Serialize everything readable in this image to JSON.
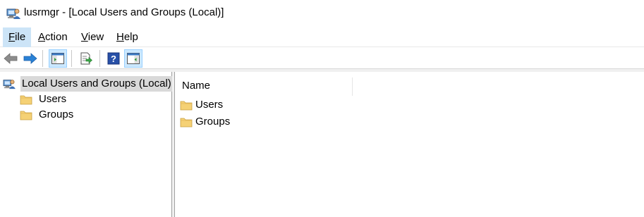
{
  "window": {
    "title": "lusrmgr - [Local Users and Groups (Local)]",
    "app_icon": "computer-users-icon"
  },
  "menubar": {
    "items": [
      {
        "accel": "F",
        "rest": "ile"
      },
      {
        "accel": "A",
        "rest": "ction"
      },
      {
        "accel": "V",
        "rest": "iew"
      },
      {
        "accel": "H",
        "rest": "elp"
      }
    ],
    "active_index": 0
  },
  "toolbar": {
    "buttons": [
      "back-arrow-icon",
      "forward-arrow-icon",
      "show-hide-console-tree-icon",
      "export-list-icon",
      "help-icon",
      "show-hide-action-pane-icon"
    ]
  },
  "tree": {
    "root": {
      "label": "Local Users and Groups (Local)",
      "icon": "computer-users-icon"
    },
    "children": [
      {
        "label": "Users",
        "icon": "folder-icon"
      },
      {
        "label": "Groups",
        "icon": "folder-icon"
      }
    ]
  },
  "list": {
    "columns": [
      "Name"
    ],
    "rows": [
      {
        "name": "Users",
        "icon": "folder-icon"
      },
      {
        "name": "Groups",
        "icon": "folder-icon"
      }
    ]
  },
  "colors": {
    "menu_active": "#cce4f7",
    "toolbar_pressed": "#cce8ff",
    "tree_selection": "#d9d9d9",
    "folder": "#f5d175",
    "arrow": "#2a82d6"
  }
}
